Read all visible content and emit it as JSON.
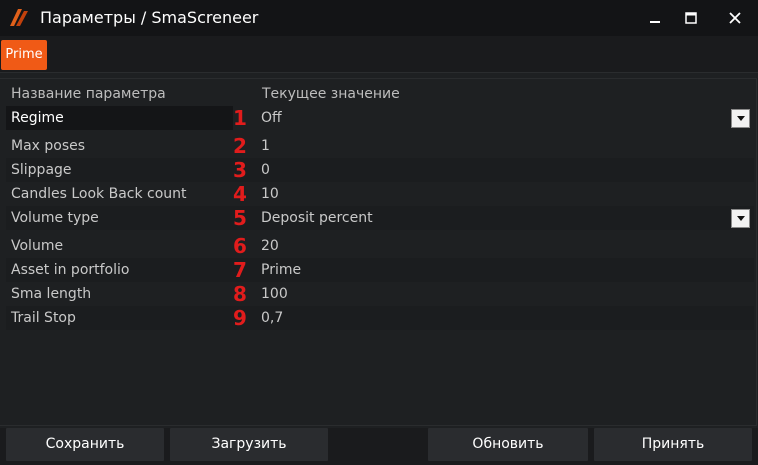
{
  "window": {
    "title": "Параметры / SmaScreneer",
    "minimize_icon": "minimize-icon",
    "maximize_icon": "maximize-icon",
    "close_icon": "close-icon"
  },
  "tabs": [
    {
      "label": "Prime",
      "active": true
    }
  ],
  "grid": {
    "headers": {
      "name": "Название параметра",
      "value": "Текущее значение"
    },
    "rows": [
      {
        "num": "1",
        "name": "Regime",
        "value": "Off",
        "dropdown": true
      },
      {
        "num": "2",
        "name": "Max poses",
        "value": "1"
      },
      {
        "num": "3",
        "name": "Slippage",
        "value": "0"
      },
      {
        "num": "4",
        "name": "Candles Look Back count",
        "value": "10"
      },
      {
        "num": "5",
        "name": "Volume type",
        "value": "Deposit percent",
        "dropdown": true
      },
      {
        "num": "6",
        "name": "Volume",
        "value": "20"
      },
      {
        "num": "7",
        "name": "Asset in portfolio",
        "value": "Prime"
      },
      {
        "num": "8",
        "name": "Sma length",
        "value": "100"
      },
      {
        "num": "9",
        "name": "Trail Stop",
        "value": "0,7"
      }
    ]
  },
  "footer": {
    "save": "Сохранить",
    "load": "Загрузить",
    "refresh": "Обновить",
    "accept": "Принять"
  },
  "colors": {
    "accent": "#f05a16",
    "annotation": "#e11c1c",
    "background": "#1e2022",
    "titlebar": "#131416"
  }
}
